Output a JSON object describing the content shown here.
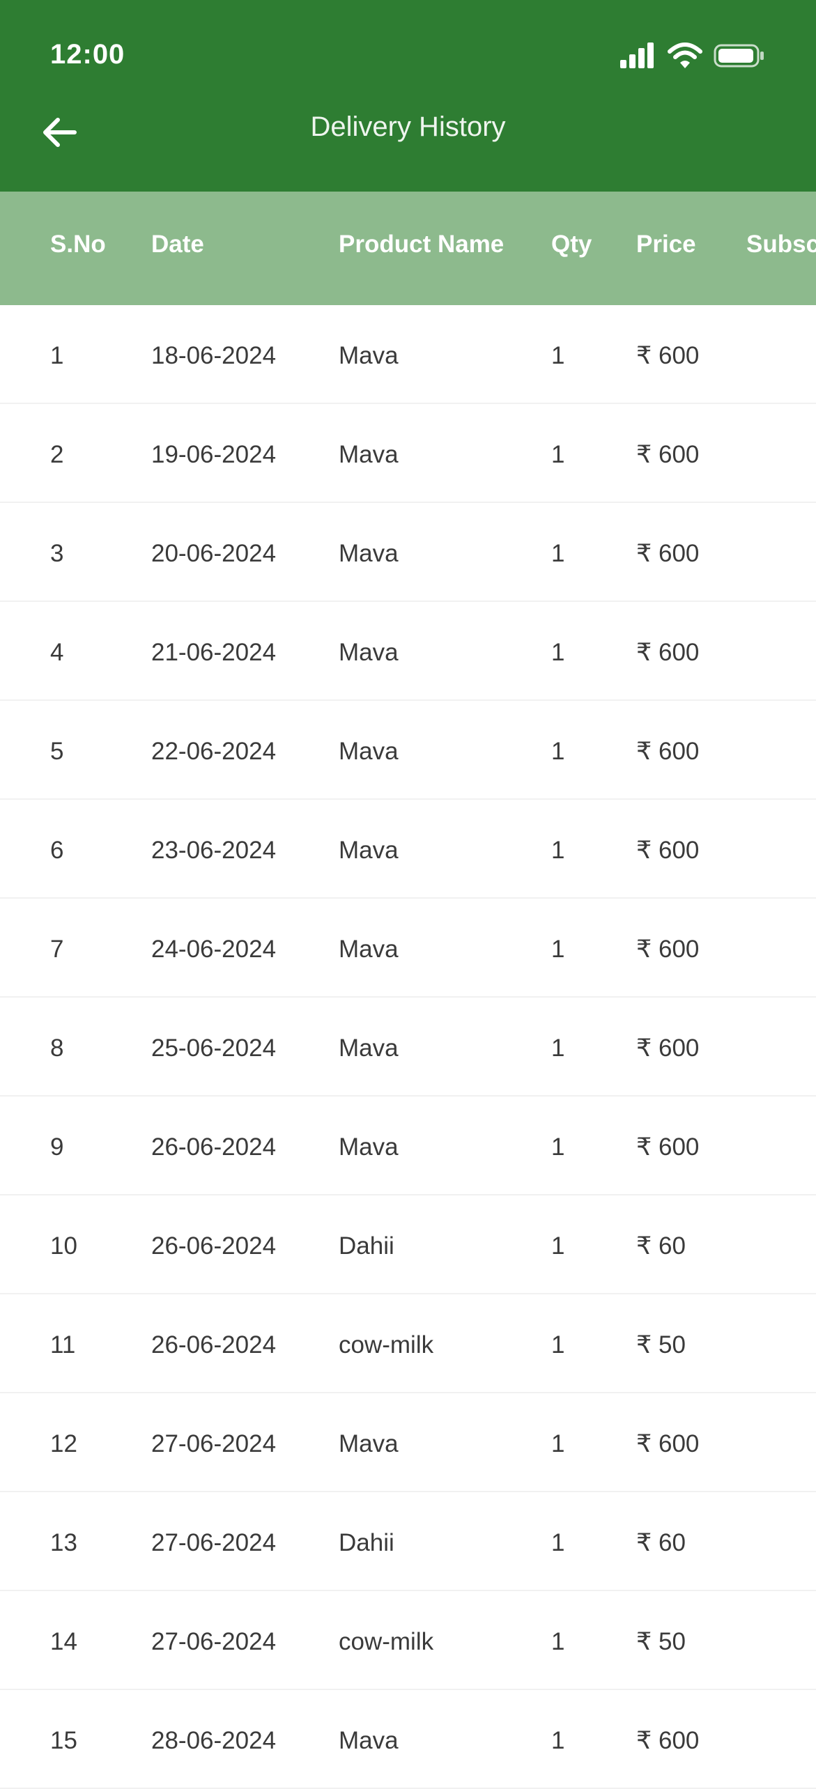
{
  "status_bar": {
    "time": "12:00"
  },
  "app_bar": {
    "title": "Delivery History",
    "back_icon": "arrow-left-icon"
  },
  "colors": {
    "app_bar": "#2e7d32",
    "table_header": "#8dba8d"
  },
  "table": {
    "headers": [
      "S.No",
      "Date",
      "Product Name",
      "Qty",
      "Price",
      "Subsc"
    ],
    "rows": [
      {
        "sno": "1",
        "date": "18-06-2024",
        "product": "Mava",
        "qty": "1",
        "price": "₹ 600"
      },
      {
        "sno": "2",
        "date": "19-06-2024",
        "product": "Mava",
        "qty": "1",
        "price": "₹ 600"
      },
      {
        "sno": "3",
        "date": "20-06-2024",
        "product": "Mava",
        "qty": "1",
        "price": "₹ 600"
      },
      {
        "sno": "4",
        "date": "21-06-2024",
        "product": "Mava",
        "qty": "1",
        "price": "₹ 600"
      },
      {
        "sno": "5",
        "date": "22-06-2024",
        "product": "Mava",
        "qty": "1",
        "price": "₹ 600"
      },
      {
        "sno": "6",
        "date": "23-06-2024",
        "product": "Mava",
        "qty": "1",
        "price": "₹ 600"
      },
      {
        "sno": "7",
        "date": "24-06-2024",
        "product": "Mava",
        "qty": "1",
        "price": "₹ 600"
      },
      {
        "sno": "8",
        "date": "25-06-2024",
        "product": "Mava",
        "qty": "1",
        "price": "₹ 600"
      },
      {
        "sno": "9",
        "date": "26-06-2024",
        "product": "Mava",
        "qty": "1",
        "price": "₹ 600"
      },
      {
        "sno": "10",
        "date": "26-06-2024",
        "product": "Dahii",
        "qty": "1",
        "price": "₹ 60"
      },
      {
        "sno": "11",
        "date": "26-06-2024",
        "product": "cow-milk",
        "qty": "1",
        "price": "₹ 50"
      },
      {
        "sno": "12",
        "date": "27-06-2024",
        "product": "Mava",
        "qty": "1",
        "price": "₹ 600"
      },
      {
        "sno": "13",
        "date": "27-06-2024",
        "product": "Dahii",
        "qty": "1",
        "price": "₹ 60"
      },
      {
        "sno": "14",
        "date": "27-06-2024",
        "product": "cow-milk",
        "qty": "1",
        "price": "₹ 50"
      },
      {
        "sno": "15",
        "date": "28-06-2024",
        "product": "Mava",
        "qty": "1",
        "price": "₹ 600"
      }
    ]
  }
}
